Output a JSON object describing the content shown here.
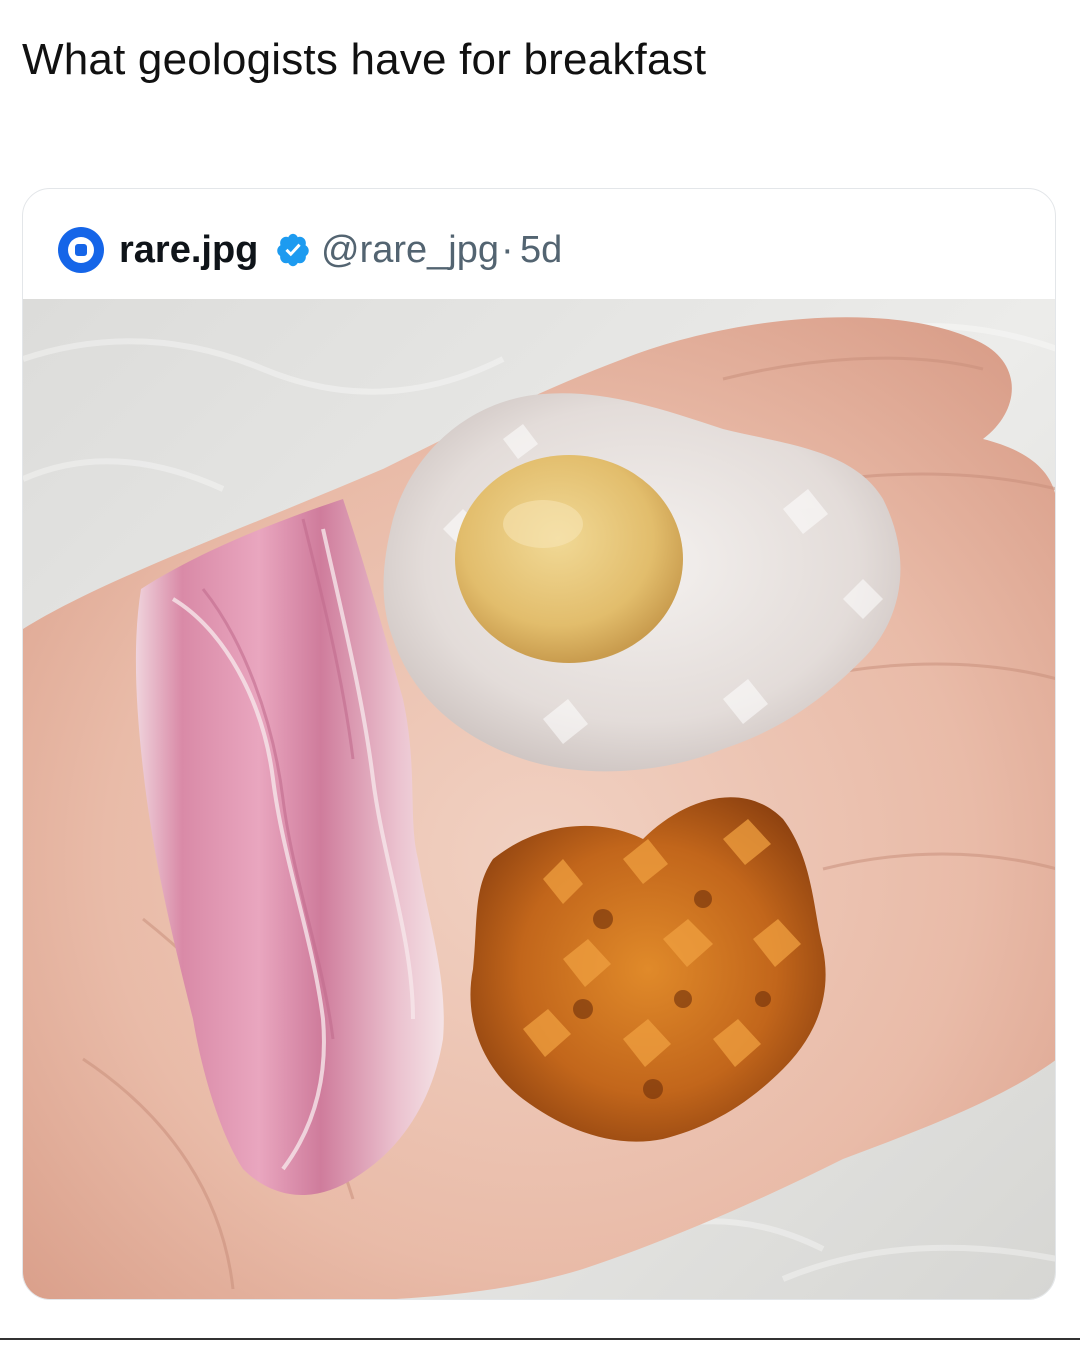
{
  "post": {
    "caption": "What geologists have for breakfast"
  },
  "quoted_tweet": {
    "display_name": "rare.jpg",
    "handle": "@rare_jpg",
    "separator": "·",
    "time": "5d",
    "verified": true,
    "avatar_icon": "globe-logo-icon",
    "accent_color": "#1d9bf0",
    "photo_alt": "Three minerals on a palm arranged like breakfast: pink banded rhodochrosite slice as bacon, white quartz geode with yellow fluorite dome as a fried egg, orange garnet crystal cluster as hash browns"
  }
}
